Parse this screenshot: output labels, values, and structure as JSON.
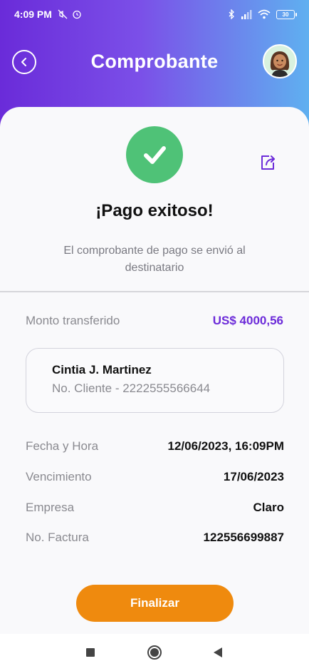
{
  "status_bar": {
    "time": "4:09 PM",
    "battery": "30"
  },
  "header": {
    "title": "Comprobante"
  },
  "receipt": {
    "success_title": "¡Pago exitoso!",
    "success_subtitle": "El comprobante de pago se envió al destinatario",
    "amount_label": "Monto transferido",
    "amount_value": "US$ 4000,56",
    "client_name": "Cintia J. Martinez",
    "client_id": "No. Cliente - 2222555566644",
    "details": [
      {
        "label": "Fecha y Hora",
        "value": "12/06/2023, 16:09PM"
      },
      {
        "label": "Vencimiento",
        "value": "17/06/2023"
      },
      {
        "label": "Empresa",
        "value": "Claro"
      },
      {
        "label": "No. Factura",
        "value": "122556699887"
      }
    ],
    "finish_label": "Finalizar"
  },
  "colors": {
    "accent_purple": "#6c2bd9",
    "success_green": "#4fc277",
    "button_orange": "#ef8a0e"
  },
  "icons": [
    "back-icon",
    "avatar",
    "check-icon",
    "share-icon",
    "bluetooth-icon",
    "signal-icon",
    "wifi-icon",
    "battery-icon"
  ]
}
